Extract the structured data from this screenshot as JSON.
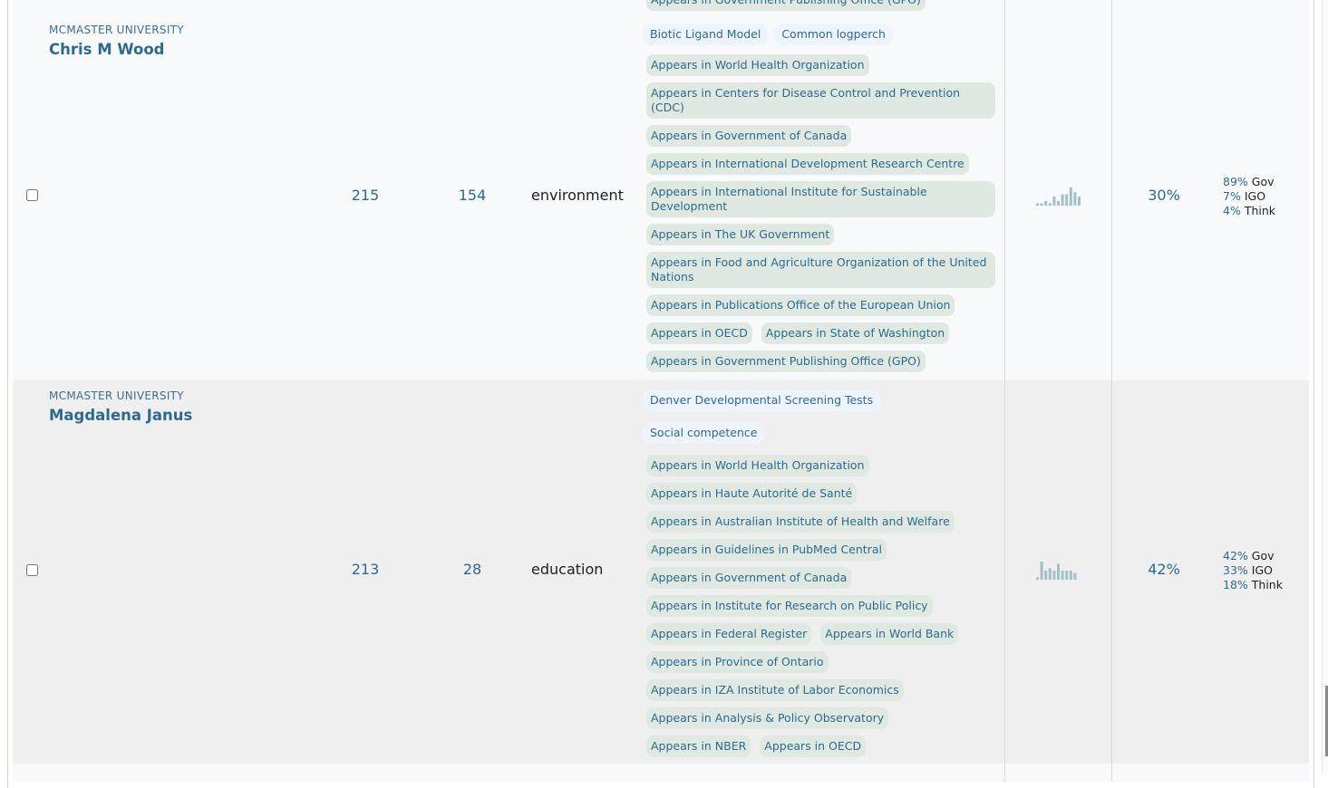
{
  "rows": [
    {
      "university": "MCMASTER UNIVERSITY",
      "name": "Chris M Wood",
      "count1": "215",
      "count2": "154",
      "field": "environment",
      "topics": [
        "Biotic Ligand Model",
        "Common logperch"
      ],
      "appearances": [
        "Appears in World Health Organization",
        "Appears in Centers for Disease Control and Prevention (CDC)",
        "Appears in Government of Canada",
        "Appears in International Development Research Centre",
        "Appears in International Institute for Sustainable Development",
        "Appears in The UK Government",
        "Appears in Food and Agriculture Organization of the United Nations",
        "Appears in Publications Office of the European Union",
        "Appears in OECD",
        "Appears in State of Washington",
        "Appears in Government Publishing Office (GPO)"
      ],
      "sparkline": [
        1,
        1,
        2,
        1,
        4,
        2,
        5,
        5,
        8,
        6,
        4
      ],
      "percent": "30%",
      "split": [
        {
          "pct": "89%",
          "label": "Gov"
        },
        {
          "pct": "7%",
          "label": "IGO"
        },
        {
          "pct": "4%",
          "label": "Think"
        }
      ]
    },
    {
      "university": "MCMASTER UNIVERSITY",
      "name": "Magdalena Janus",
      "count1": "213",
      "count2": "28",
      "field": "education",
      "topics": [
        "Denver Developmental Screening Tests",
        "Social competence"
      ],
      "appearances": [
        "Appears in World Health Organization",
        "Appears in Haute Autorité de Santé",
        "Appears in Australian Institute of Health and Welfare",
        "Appears in Guidelines in PubMed Central",
        "Appears in Government of Canada",
        "Appears in Institute for Research on Public Policy",
        "Appears in Federal Register",
        "Appears in World Bank",
        "Appears in Province of Ontario",
        "Appears in IZA Institute of Labor Economics",
        "Appears in Analysis & Policy Observatory",
        "Appears in NBER",
        "Appears in OECD"
      ],
      "sparkline": [
        1,
        8,
        4,
        5,
        4,
        7,
        4,
        4,
        4,
        3
      ],
      "percent": "42%",
      "split": [
        {
          "pct": "42%",
          "label": "Gov"
        },
        {
          "pct": "33%",
          "label": "IGO"
        },
        {
          "pct": "18%",
          "label": "Think"
        }
      ]
    }
  ],
  "top_partial_tag": "Appears in Government Publishing Office (GPO)"
}
